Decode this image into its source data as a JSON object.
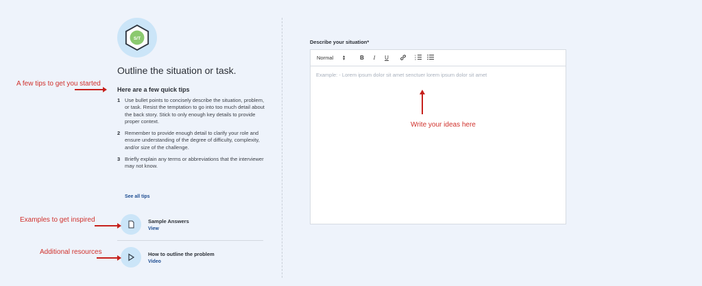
{
  "guide": {
    "badge_text": "S/T",
    "title": "Outline the situation or task.",
    "tips_heading": "Here are a few quick tips",
    "tips": [
      {
        "num": "1",
        "text": "Use bullet points to concisely describe the situation, problem, or task. Resist the temptation to go into too much detail about the back story. Stick to only enough key details to provide proper context."
      },
      {
        "num": "2",
        "text": "Remember to provide enough detail to clarify your role and ensure understanding of the degree of difficulty, complexity, and/or size of the challenge."
      },
      {
        "num": "3",
        "text": "Briefly explain any terms or abbreviations that the interviewer may not know."
      }
    ],
    "see_all": "See all tips",
    "resources": [
      {
        "title": "Sample Answers",
        "link": "View",
        "icon": "document-icon"
      },
      {
        "title": "How to outline the problem",
        "link": "Video",
        "icon": "play-icon"
      }
    ]
  },
  "editor": {
    "label": "Describe your situation*",
    "format_select": "Normal",
    "toolbar": {
      "bold": "B",
      "italic": "I",
      "underline": "U"
    },
    "placeholder": "Example: - Lorem ipsum dolor sit amet senctuer lorem ipsum dolor sit amet"
  },
  "annotations": {
    "tips": "A few tips to get you started",
    "examples": "Examples to get inspired",
    "resources": "Additional resources",
    "editor": "Write your ideas here"
  },
  "colors": {
    "background": "#eef3fb",
    "accent_blue": "#1f4e92",
    "annotation_red": "#d0302b",
    "badge_green": "#8bc96f"
  }
}
